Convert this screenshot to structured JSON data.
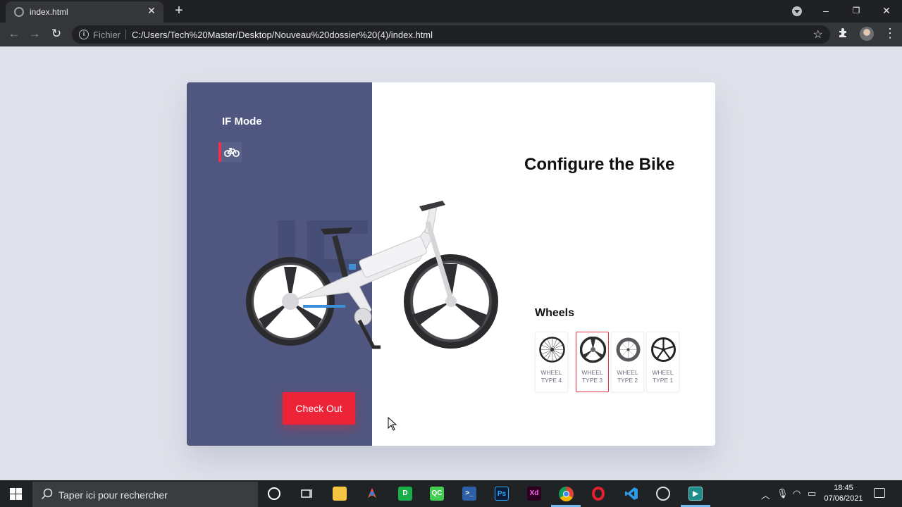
{
  "browser": {
    "tab_title": "index.html",
    "tab_close": "✕",
    "new_tab": "+",
    "security_label": "Fichier",
    "url": "C:/Users/Tech%20Master/Desktop/Nouveau%20dossier%20(4)/index.html",
    "icons": [
      "back-icon",
      "forward-icon",
      "reload-icon",
      "info-icon",
      "star-icon",
      "extensions-icon",
      "profile-icon",
      "menu-icon"
    ],
    "window_controls": {
      "minimize": "–",
      "restore": "❐",
      "close": "✕"
    }
  },
  "app": {
    "brand": "IF Mode",
    "background_text": "IF",
    "heading": "Configure the Bike",
    "checkout_label": "Check Out",
    "wheels_title": "Wheels",
    "wheel_options": [
      {
        "line1": "WHEEL",
        "line2": "TYPE 4",
        "selected": false
      },
      {
        "line1": "WHEEL",
        "line2": "TYPE 3",
        "selected": true
      },
      {
        "line1": "WHEEL",
        "line2": "TYPE 2",
        "selected": false
      },
      {
        "line1": "WHEEL",
        "line2": "TYPE 1",
        "selected": false
      }
    ],
    "colors": {
      "panel": "#4f567f",
      "accent": "#ed2437",
      "page_bg": "#dfe1ea"
    }
  },
  "taskbar": {
    "search_placeholder": "Taper ici pour rechercher",
    "app_icons": [
      "cortana-icon",
      "task-view-icon",
      "file-explorer-icon",
      "git-icon",
      "green-app-icon",
      "qt-creator-icon",
      "powershell-icon",
      "photoshop-icon",
      "xd-icon",
      "chrome-icon",
      "opera-icon",
      "vscode-icon",
      "obs-icon",
      "terminal-app-icon"
    ],
    "labels": {
      "photoshop": "Ps",
      "xd": "Xd",
      "qt": "QC"
    },
    "time": "18:45",
    "date": "07/06/2021"
  }
}
